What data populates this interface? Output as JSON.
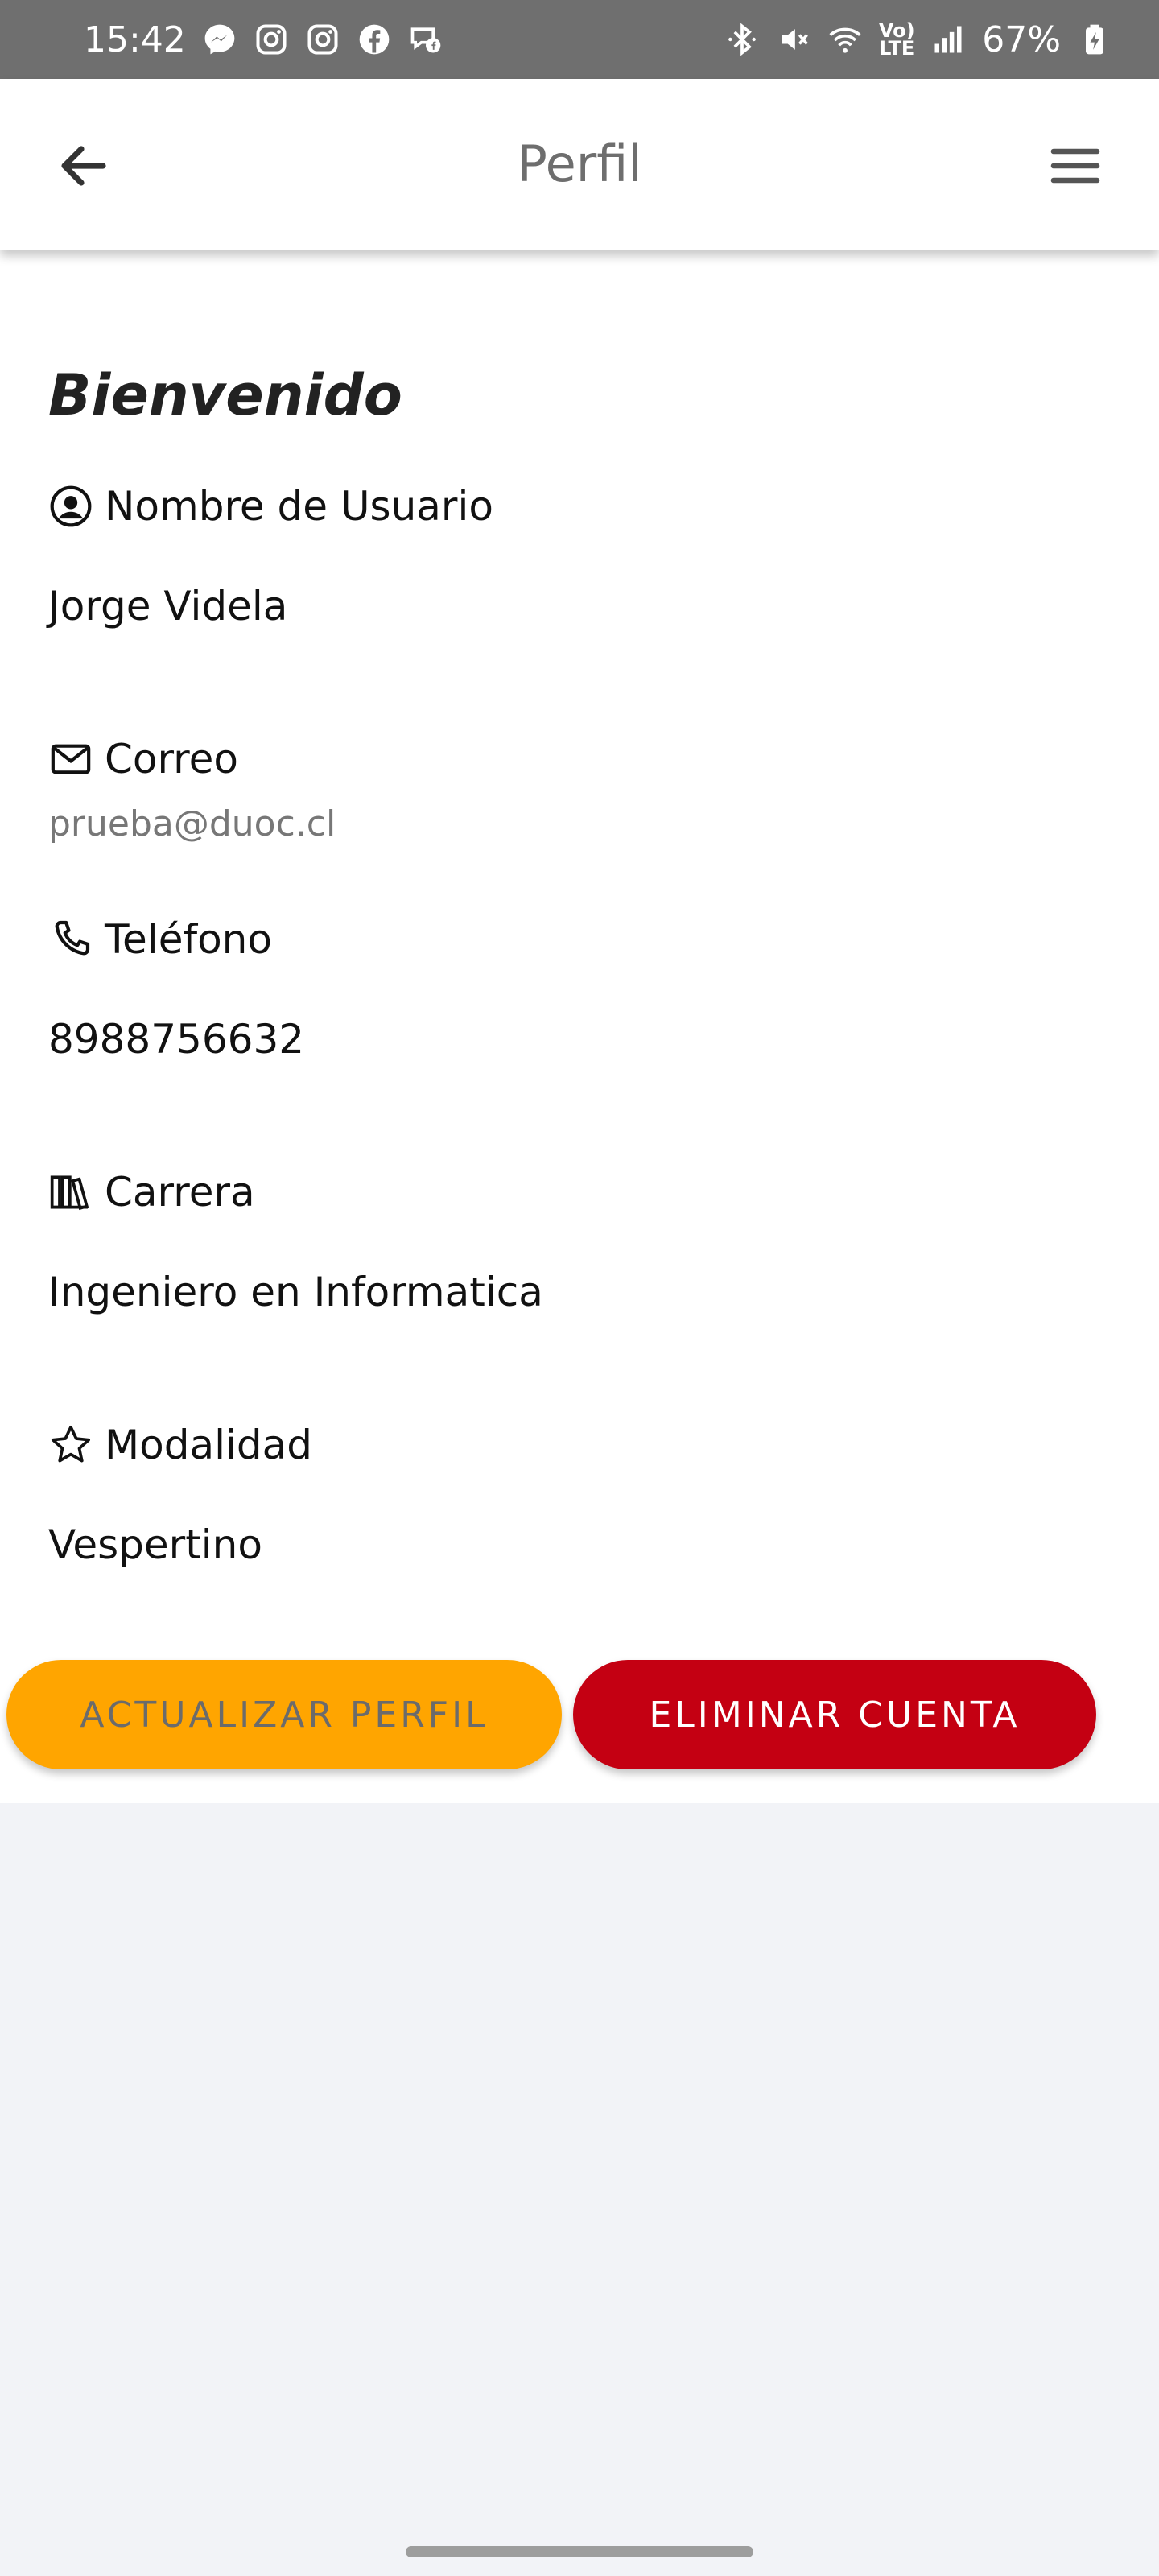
{
  "status_bar": {
    "time": "15:42",
    "battery": "67%",
    "volte_top": "Vo)",
    "volte_bottom": "LTE",
    "notification_icons": [
      "messenger-icon",
      "instagram-icon",
      "instagram-icon",
      "facebook-icon",
      "chat-icon"
    ],
    "system_icons": [
      "bluetooth-icon",
      "mute-icon",
      "wifi-icon",
      "volte-icon",
      "signal-icon",
      "battery-icon"
    ]
  },
  "app_bar": {
    "title": "Perfil",
    "back_icon": "arrow-left-icon",
    "menu_icon": "hamburger-menu-icon"
  },
  "profile": {
    "welcome": "Bienvenido",
    "fields": [
      {
        "label": "Nombre de Usuario",
        "value": "Jorge Videla",
        "icon": "user-circle-icon"
      },
      {
        "label": "Correo",
        "value": "prueba@duoc.cl",
        "icon": "mail-icon"
      },
      {
        "label": "Teléfono",
        "value": "8988756632",
        "icon": "phone-icon"
      },
      {
        "label": "Carrera",
        "value": "Ingeniero en Informatica",
        "icon": "library-icon"
      },
      {
        "label": "Modalidad",
        "value": "Vespertino",
        "icon": "star-icon"
      }
    ]
  },
  "actions": {
    "update_label": "ACTUALIZAR PERFIL",
    "delete_label": "ELIMINAR CUENTA"
  },
  "colors": {
    "status_bar": "#6f6f6f",
    "update_button": "#ffa500",
    "delete_button": "#c40012",
    "page_background": "#f2f3f7"
  }
}
